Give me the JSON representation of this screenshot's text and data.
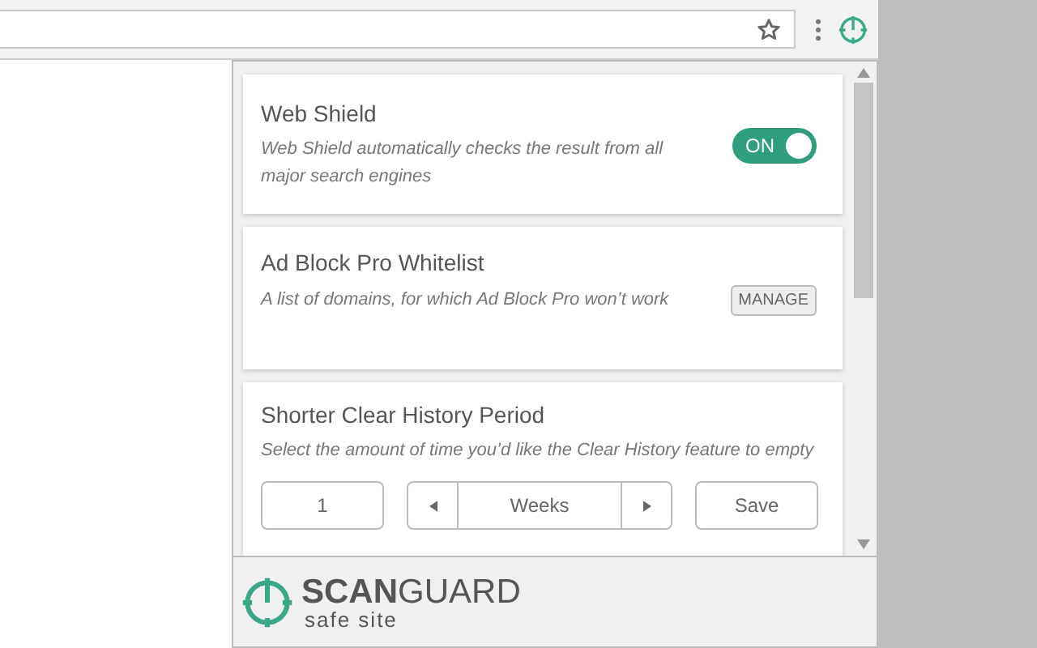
{
  "cards": [
    {
      "kind": "toggle",
      "title": "Web Shield",
      "description": "Web Shield automatically checks the result from all major search engines",
      "toggle": {
        "label": "ON",
        "on": true
      }
    },
    {
      "kind": "action",
      "title": "Ad Block Pro Whitelist",
      "description": "A list of domains, for which Ad Block Pro won’t work",
      "button": "MANAGE"
    },
    {
      "kind": "period",
      "title": "Shorter Clear History Period",
      "description": "Select the amount of time you’d like the Clear History feature to empty",
      "amount": "1",
      "unit": "Weeks",
      "button": "Save"
    }
  ],
  "footer": {
    "brand": "**SCAN**GUARD",
    "tagline": "safe site"
  }
}
